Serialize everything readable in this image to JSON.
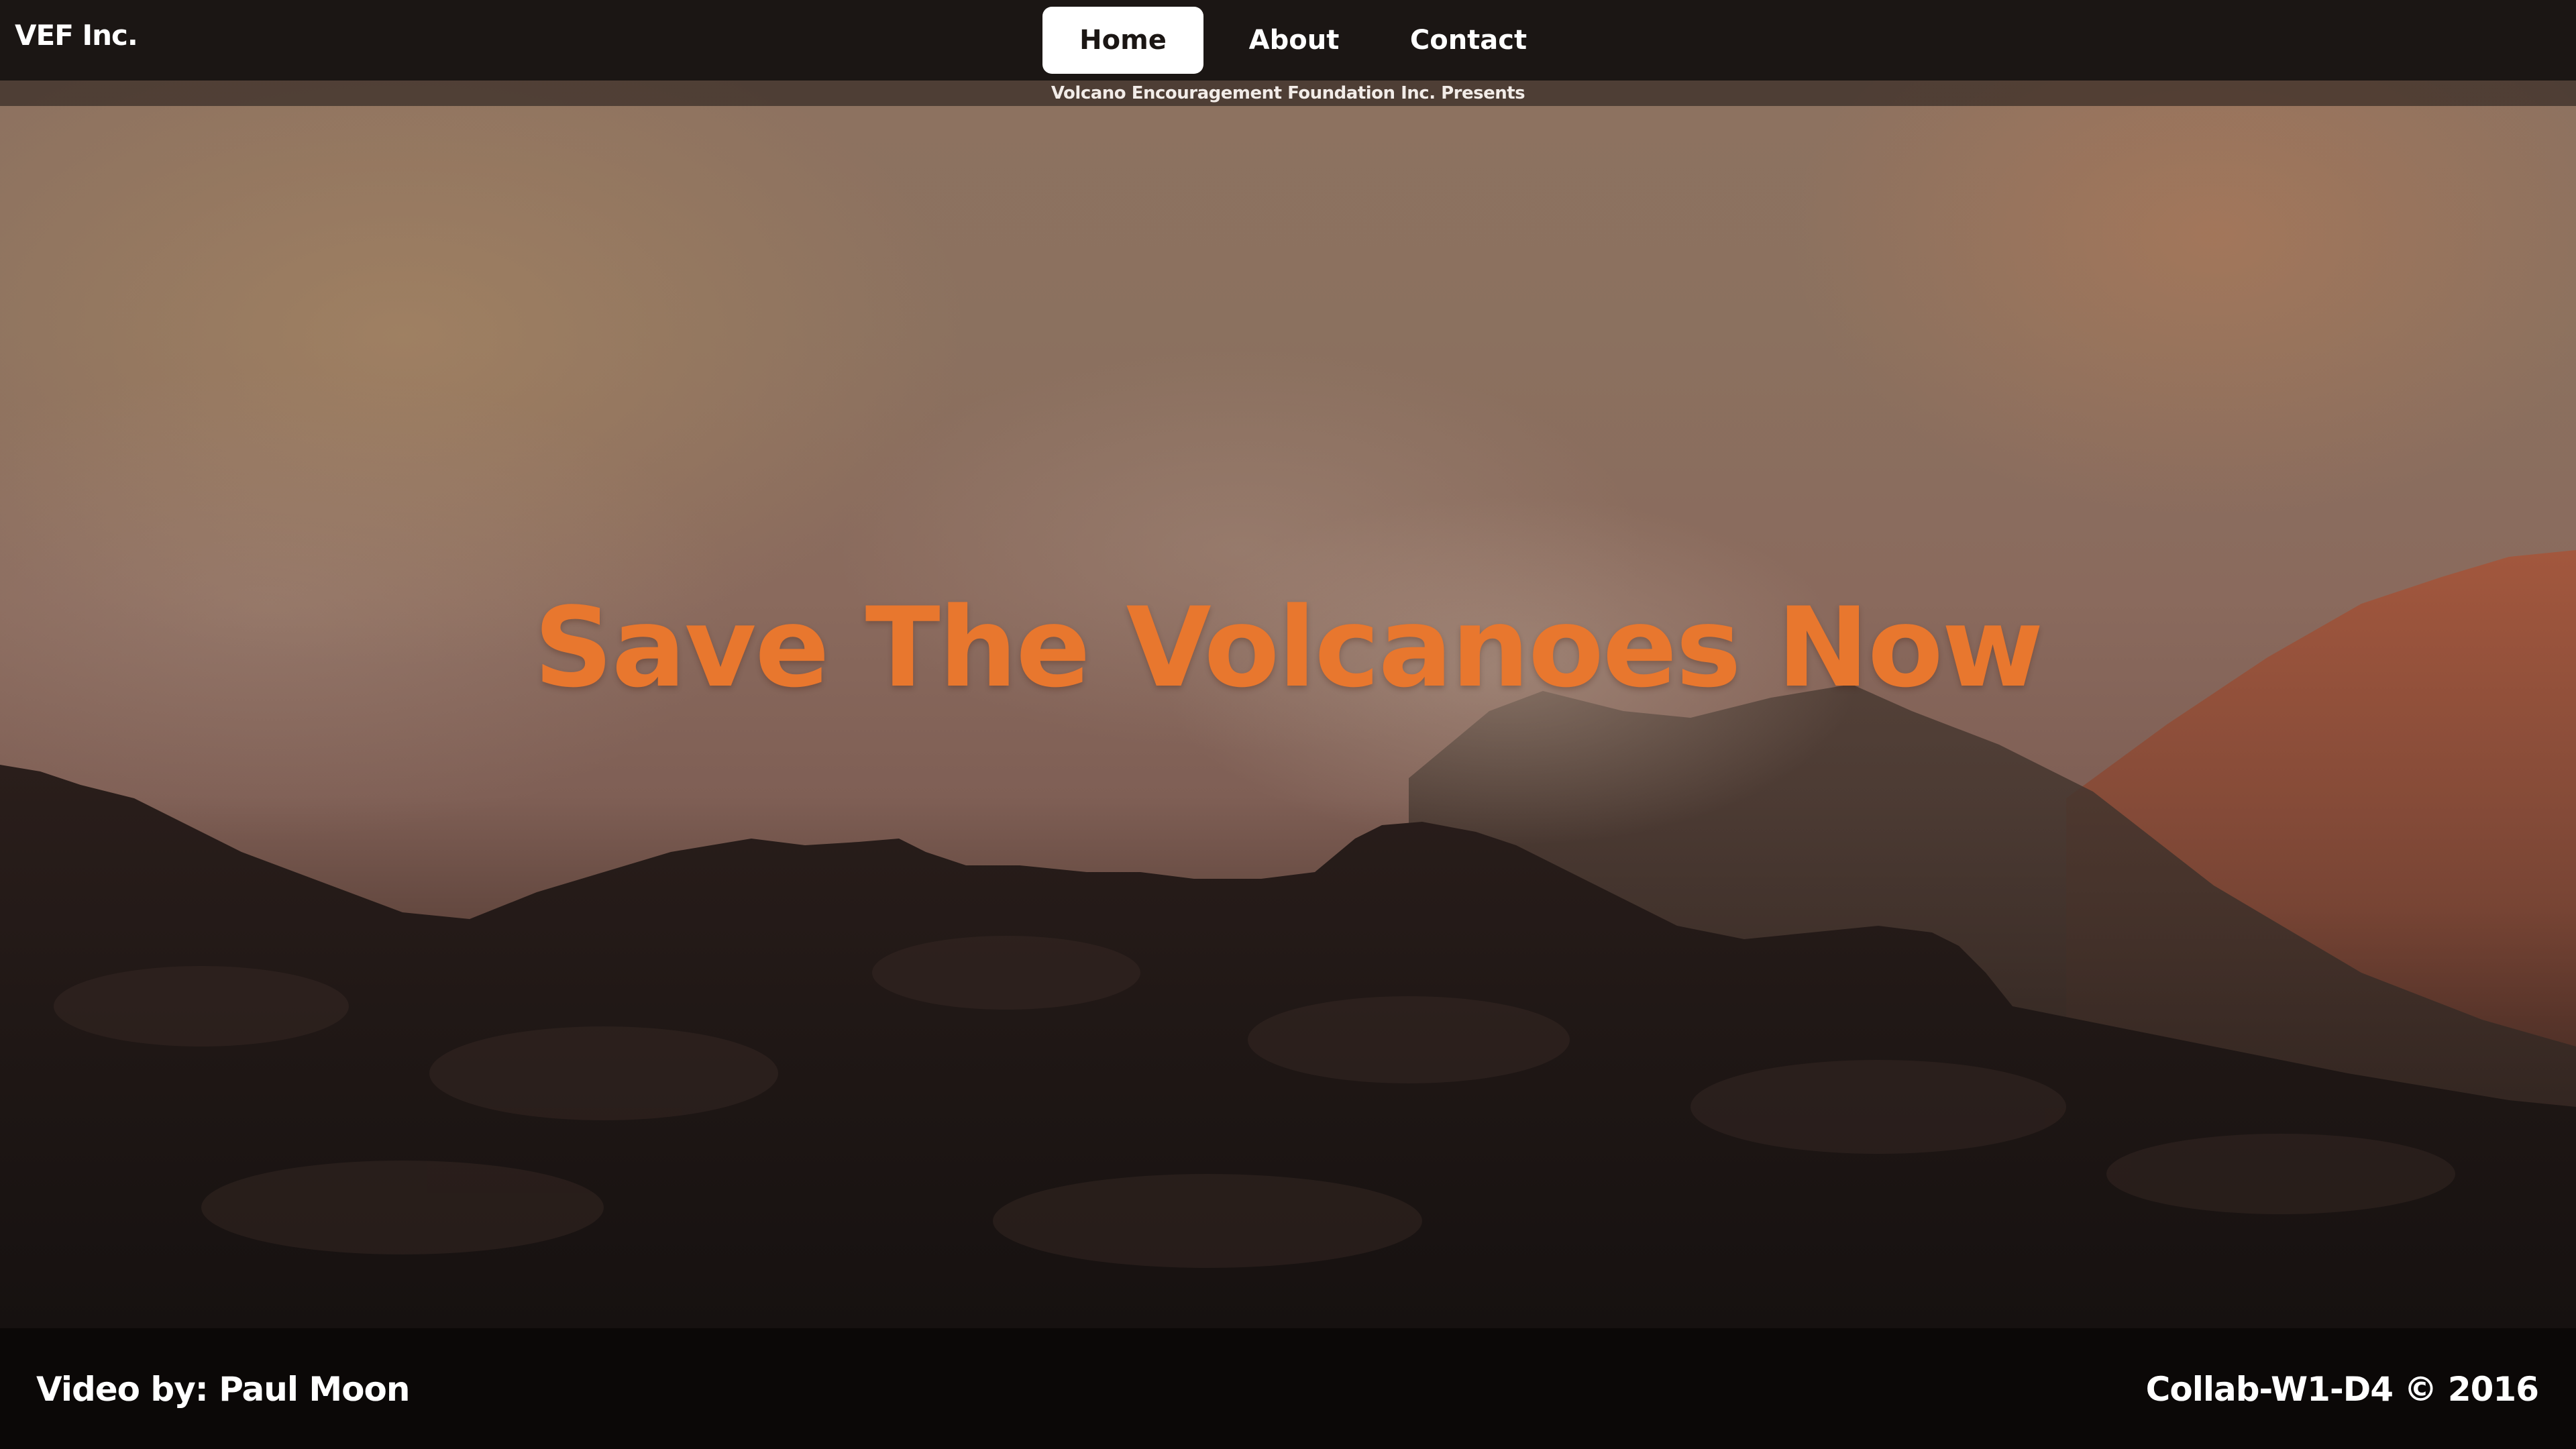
{
  "brand": {
    "name": "VEF Inc."
  },
  "nav": {
    "items": [
      {
        "label": "Home",
        "active": true
      },
      {
        "label": "About",
        "active": false
      },
      {
        "label": "Contact",
        "active": false
      }
    ]
  },
  "subtitle": "Volcano Encouragement Foundation Inc. Presents",
  "hero": {
    "headline": "Save The Volcanoes Now"
  },
  "footer": {
    "credit": "Video by: Paul Moon",
    "copyright": "Collab-W1-D4 © 2016"
  },
  "colors": {
    "accent": "#e8772e",
    "navbar": "#1b1614",
    "footer": "#0b0807",
    "active_tab_bg": "#ffffff"
  }
}
